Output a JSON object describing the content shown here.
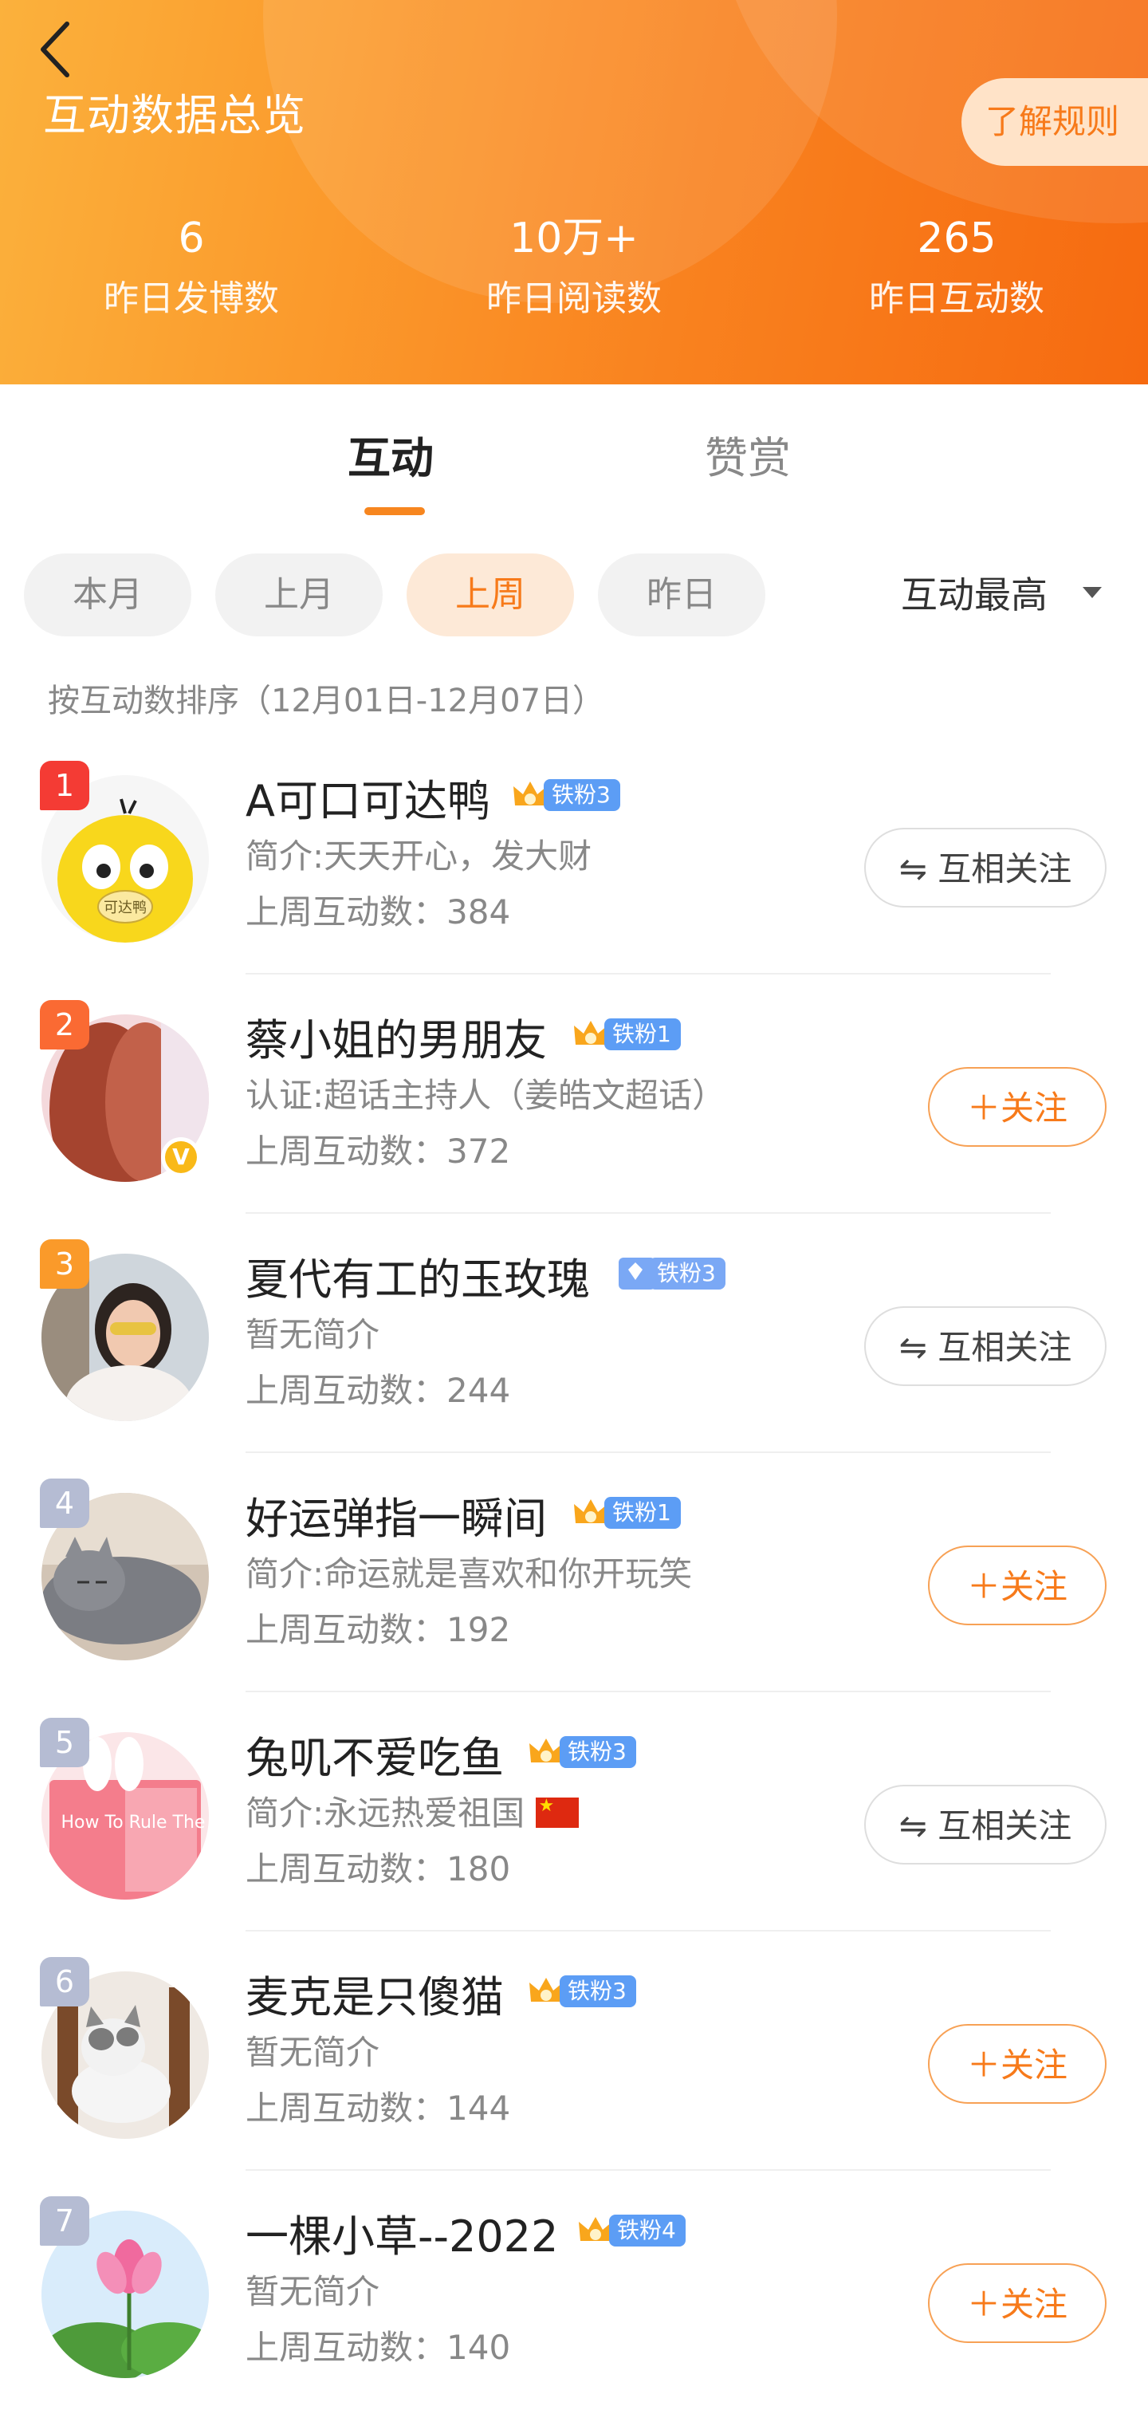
{
  "header": {
    "title": "互动数据总览",
    "rules_button": "了解规则",
    "stats": [
      {
        "value": "6",
        "label": "昨日发博数"
      },
      {
        "value": "10万+",
        "label": "昨日阅读数"
      },
      {
        "value": "265",
        "label": "昨日互动数"
      }
    ]
  },
  "tabs": [
    {
      "label": "互动",
      "active": true
    },
    {
      "label": "赞赏",
      "active": false
    }
  ],
  "filters": {
    "chips": [
      {
        "label": "本月",
        "active": false
      },
      {
        "label": "上月",
        "active": false
      },
      {
        "label": "上周",
        "active": true
      },
      {
        "label": "昨日",
        "active": false
      }
    ],
    "sort": "互动最高",
    "note": "按互动数排序（12月01日-12月07日）"
  },
  "users": [
    {
      "rank": "1",
      "name": "A可口可达鸭",
      "fan_level": "铁粉3",
      "desc": "简介:天天开心，发大财",
      "count": "上周互动数：384",
      "button": "互相关注",
      "button_type": "mutual"
    },
    {
      "rank": "2",
      "name": "蔡小姐的男朋友",
      "fan_level": "铁粉1",
      "desc": "认证:超话主持人（姜皓文超话）",
      "count": "上周互动数：372",
      "button": "关注",
      "button_type": "follow"
    },
    {
      "rank": "3",
      "name": "夏代有工的玉玫瑰",
      "fan_level": "铁粉3",
      "desc": "暂无简介",
      "count": "上周互动数：244",
      "button": "互相关注",
      "button_type": "mutual"
    },
    {
      "rank": "4",
      "name": "好运弹指一瞬间",
      "fan_level": "铁粉1",
      "desc": "简介:命运就是喜欢和你开玩笑",
      "count": "上周互动数：192",
      "button": "关注",
      "button_type": "follow"
    },
    {
      "rank": "5",
      "name": "兔叽不爱吃鱼",
      "fan_level": "铁粉3",
      "desc": "简介:永远热爱祖国",
      "count": "上周互动数：180",
      "button": "互相关注",
      "button_type": "mutual"
    },
    {
      "rank": "6",
      "name": "麦克是只傻猫",
      "fan_level": "铁粉3",
      "desc": "暂无简介",
      "count": "上周互动数：144",
      "button": "关注",
      "button_type": "follow"
    },
    {
      "rank": "7",
      "name": "一棵小草--2022",
      "fan_level": "铁粉4",
      "desc": "暂无简介",
      "count": "上周互动数：140",
      "button": "关注",
      "button_type": "follow"
    }
  ],
  "avatar_5_text": "How To Rule The World",
  "avatar_1_text": "可达鸭"
}
